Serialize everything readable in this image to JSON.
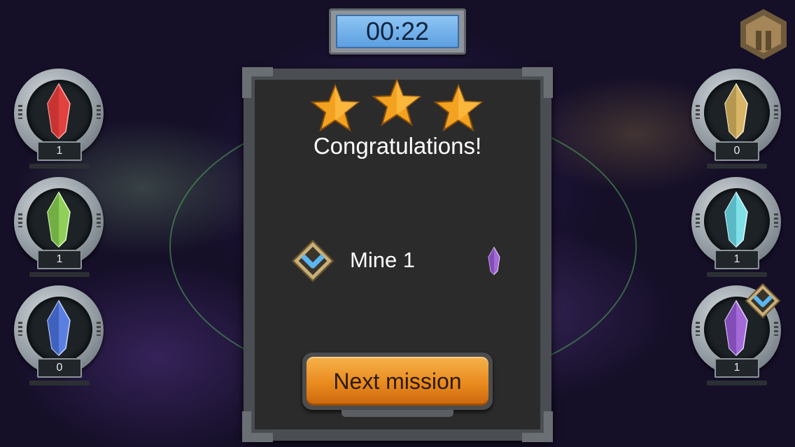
{
  "timer": {
    "value": "00:22"
  },
  "pause_button": {
    "icon": "pause-icon"
  },
  "left_slots": [
    {
      "crystal": "red-crystal-icon",
      "color": "#e2413f",
      "count": "1"
    },
    {
      "crystal": "green-crystal-icon",
      "color": "#8fcf5a",
      "count": "1"
    },
    {
      "crystal": "blue-crystal-icon",
      "color": "#5a7fe0",
      "count": "0"
    }
  ],
  "right_slots": [
    {
      "crystal": "gold-crystal-icon",
      "color": "#d8b667",
      "count": "0"
    },
    {
      "crystal": "cyan-crystal-icon",
      "color": "#7fe0e8",
      "count": "1"
    },
    {
      "crystal": "purple-crystal-icon",
      "color": "#a36ad8",
      "count": "1",
      "checked": true
    }
  ],
  "dialog": {
    "stars": 3,
    "title": "Congratulations!",
    "objective": {
      "label": "Mine 1",
      "check_icon": "check-badge-icon",
      "crystal": "purple-crystal-icon",
      "color": "#a36ad8"
    },
    "next_button_label": "Next mission"
  },
  "colors": {
    "button_orange": "#e98a1e",
    "star_gold": "#f3a21f",
    "timer_blue": "#7ab6ee",
    "check_blue": "#5ab6f0"
  }
}
